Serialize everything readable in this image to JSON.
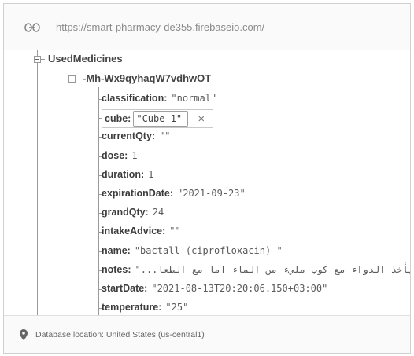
{
  "header": {
    "link_icon": "link-icon",
    "url": "https://smart-pharmacy-de355.firebaseio.com/"
  },
  "tree": {
    "root_label": "UsedMedicines",
    "record_label": "-Mh-Wx9qyhaqW7vdhwOT",
    "fields": [
      {
        "key": "classification:",
        "value": "\"normal\""
      },
      {
        "key": "cube:",
        "value": "\"Cube 1\"",
        "editing": true
      },
      {
        "key": "currentQty:",
        "value": "\"\""
      },
      {
        "key": "dose:",
        "value": "1"
      },
      {
        "key": "duration:",
        "value": "1"
      },
      {
        "key": "expirationDate:",
        "value": "\"2021-09-23\""
      },
      {
        "key": "grandQty:",
        "value": "24"
      },
      {
        "key": "intakeAdvice:",
        "value": "\"\""
      },
      {
        "key": "name:",
        "value": "\"bactall (ciprofloxacin) \""
      },
      {
        "key": "notes:",
        "value": "\"...يأخذ الدواء مع كوب مليء من الماء اما مع الطعا -\""
      },
      {
        "key": "startDate:",
        "value": "\"2021-08-13T20:20:06.150+03:00\""
      },
      {
        "key": "temperature:",
        "value": "\"25\""
      }
    ],
    "clear_icon": "close-icon",
    "clear_glyph": "×"
  },
  "footer": {
    "pin_icon": "location-pin-icon",
    "location": "Database location: United States (us-central1)"
  }
}
